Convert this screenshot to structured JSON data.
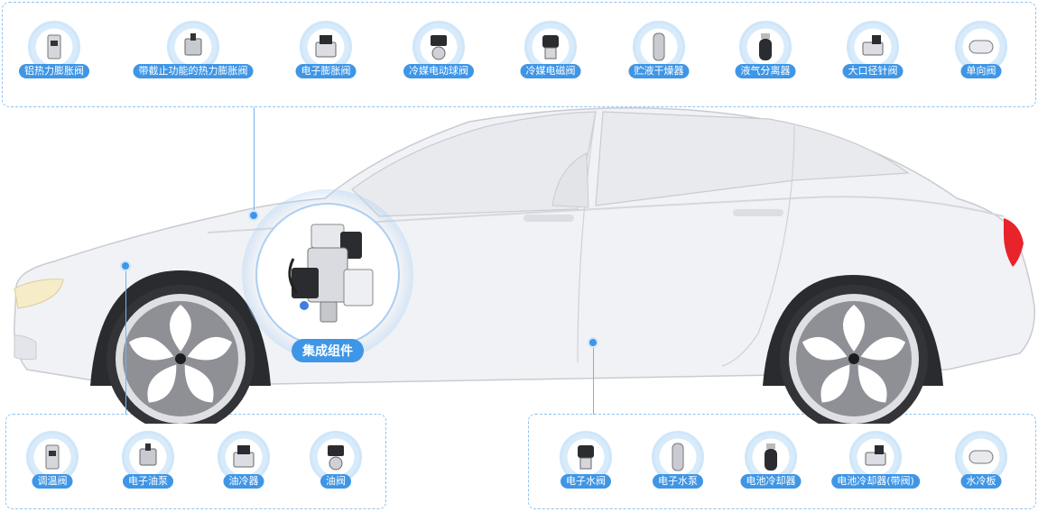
{
  "top_parts": [
    {
      "label": "铝热力膨胀阀",
      "icon": "aluminum-expansion-valve-icon"
    },
    {
      "label": "带截止功能的热力膨胀阀",
      "icon": "shutoff-expansion-valve-icon"
    },
    {
      "label": "电子膨胀阀",
      "icon": "electronic-expansion-valve-icon"
    },
    {
      "label": "冷媒电动球阀",
      "icon": "refrigerant-ball-valve-icon"
    },
    {
      "label": "冷媒电磁阀",
      "icon": "refrigerant-solenoid-valve-icon"
    },
    {
      "label": "贮液干燥器",
      "icon": "receiver-drier-icon"
    },
    {
      "label": "液气分离器",
      "icon": "gas-liquid-separator-icon"
    },
    {
      "label": "大口径针阀",
      "icon": "needle-valve-icon"
    },
    {
      "label": "单向阀",
      "icon": "check-valve-icon"
    }
  ],
  "bottom_left_parts": [
    {
      "label": "调温阀",
      "icon": "thermostat-valve-icon"
    },
    {
      "label": "电子油泵",
      "icon": "electric-oil-pump-icon"
    },
    {
      "label": "油冷器",
      "icon": "oil-cooler-icon"
    },
    {
      "label": "油阀",
      "icon": "oil-valve-icon"
    }
  ],
  "bottom_right_parts": [
    {
      "label": "电子水阀",
      "icon": "electronic-water-valve-icon"
    },
    {
      "label": "电子水泵",
      "icon": "electronic-water-pump-icon"
    },
    {
      "label": "电池冷却器",
      "icon": "battery-chiller-icon"
    },
    {
      "label": "电池冷却器(带阀)",
      "icon": "battery-chiller-valve-icon"
    },
    {
      "label": "水冷板",
      "icon": "water-cooling-plate-icon"
    }
  ],
  "center": {
    "label": "集成组件",
    "icon": "integrated-module-icon"
  },
  "colors": {
    "accent": "#3f96e6",
    "ring": "#cfe6fa",
    "car_body": "#f1f2f5",
    "car_outline": "#c9cbd3",
    "tail_light": "#e8232b"
  }
}
